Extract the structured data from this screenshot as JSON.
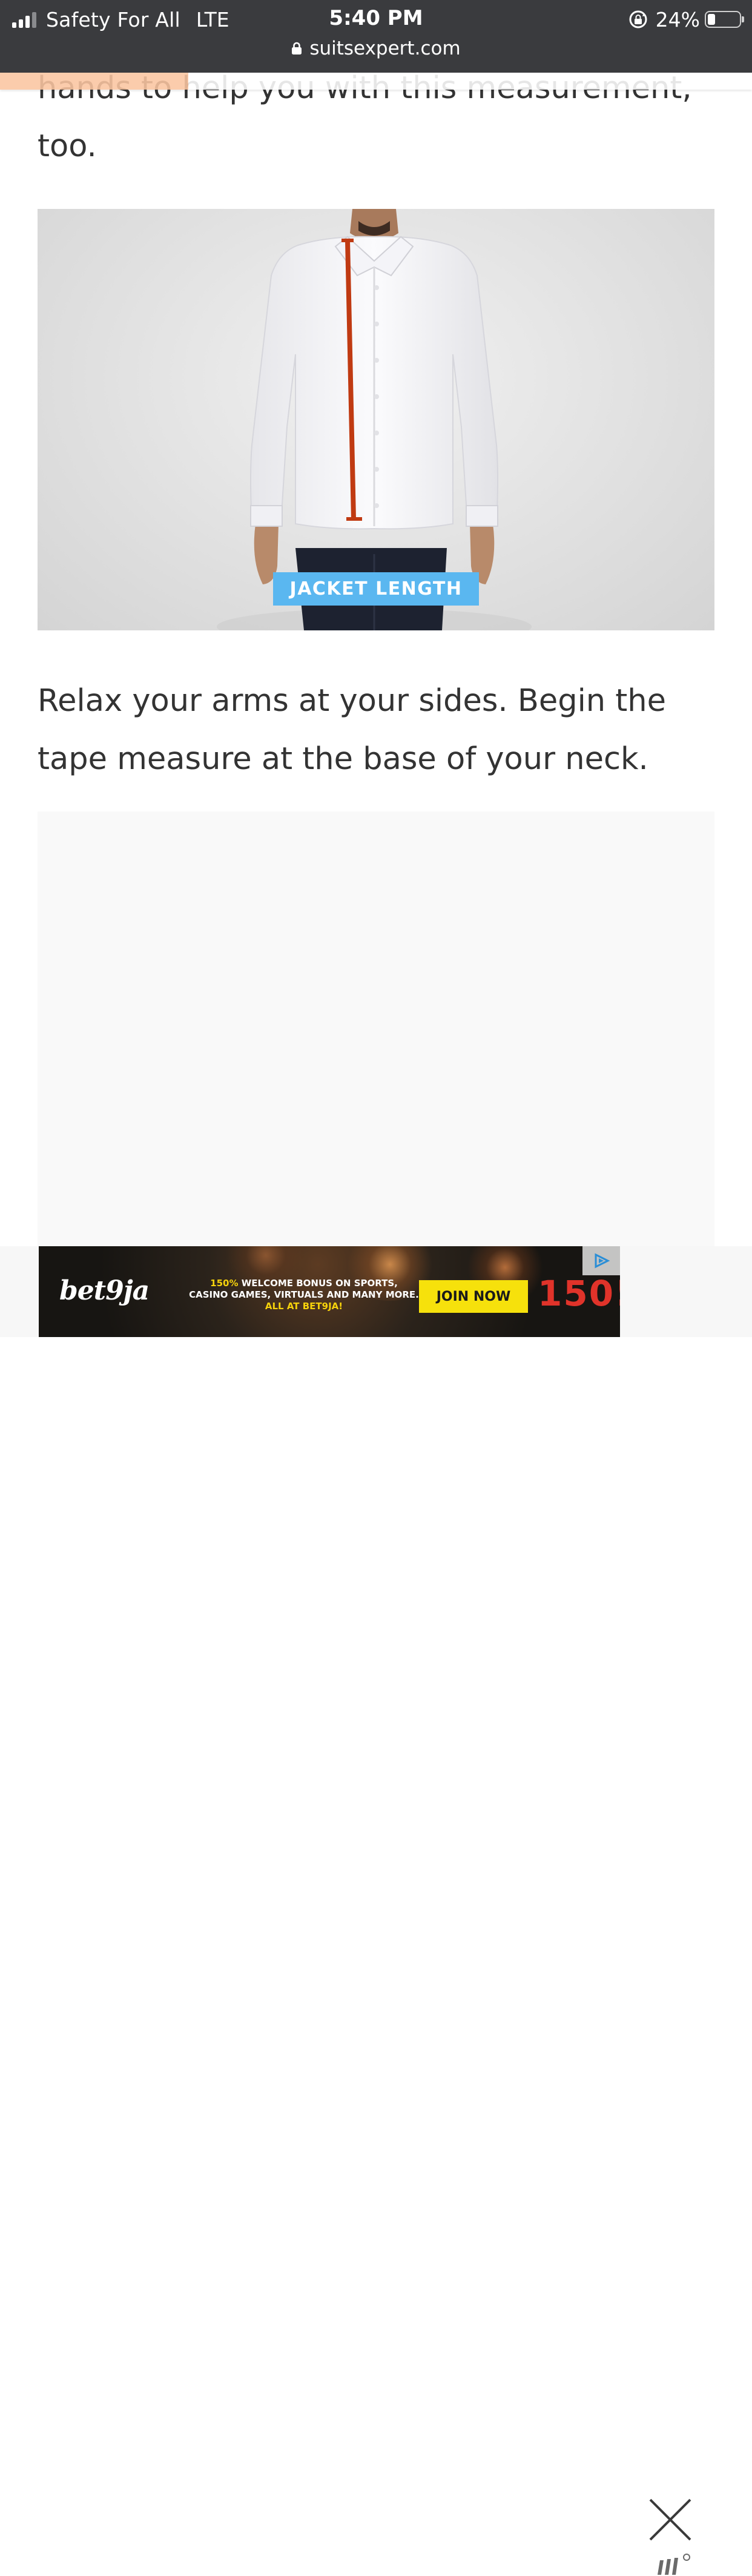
{
  "status_bar": {
    "carrier": "Safety For All",
    "network": "LTE",
    "time": "5:40 PM",
    "battery_percent": "24%",
    "battery_level": 0.24,
    "signal_bars_filled": 3,
    "url": "suitsexpert.com"
  },
  "reading_progress": 0.25,
  "article": {
    "paragraph_above": "hands to help you with this measurement, too.",
    "figure_label": "JACKET LENGTH",
    "paragraph_below": "Relax your arms at your sides. Begin the tape measure at the base of your neck."
  },
  "ad": {
    "brand": "bet9ja",
    "line1_highlight": "150%",
    "line1": "WELCOME BONUS ON SPORTS,",
    "line2": "CASINO GAMES, VIRTUALS AND MANY MORE.",
    "line3": "ALL AT BET9JA!",
    "cta": "JOIN NOW",
    "big_text": "150!"
  },
  "icons": {
    "lock": "padlock-icon",
    "rotation_lock": "rotation-lock-icon",
    "ad_choices": "adchoices-icon",
    "close": "close-icon",
    "ad_network": "ad-network-logo"
  },
  "colors": {
    "status_bar": "#3a3b3e",
    "progress_fill": "#fbc5a1",
    "label_bg": "#5ab7f0",
    "tape": "#c03a12",
    "ad_cta": "#f6e10c",
    "ad_big": "#e0332a"
  }
}
